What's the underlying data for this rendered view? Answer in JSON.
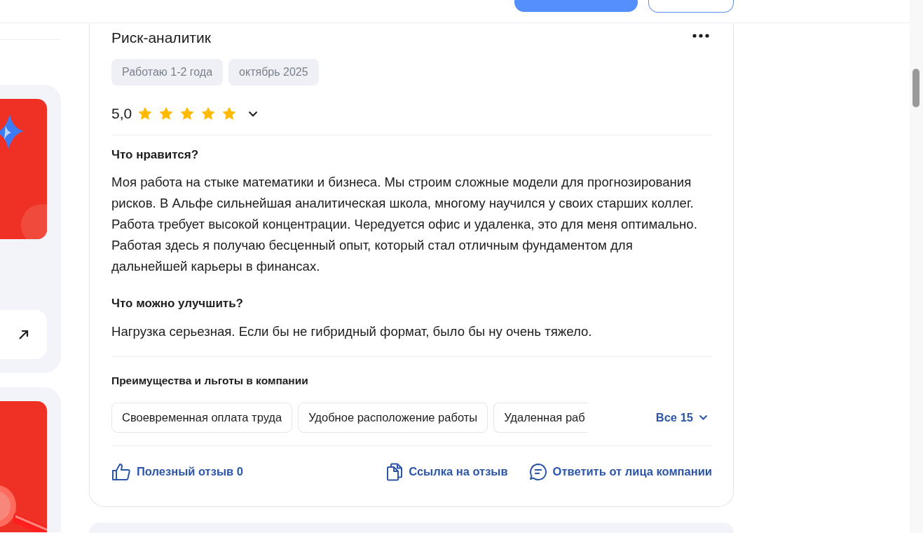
{
  "review": {
    "title": "Риск-аналитик",
    "tags": [
      "Работаю 1-2 года",
      "октябрь 2025"
    ],
    "rating": "5,0",
    "stars": 5,
    "sections": [
      {
        "heading": "Что нравится?",
        "text": "Моя работа на стыке математики и бизнеса. Мы строим сложные модели для прогнозирования рисков. В Альфе сильнейшая аналитическая школа, многому научился у своих старших коллег. Работа требует высокой концентрации. Чередуется офис и удаленка, это для меня оптимально. Работая здесь я получаю бесценный опыт, который стал отличным фундаментом для дальнейшей карьеры в финансах."
      },
      {
        "heading": "Что можно улучшить?",
        "text": "Нагрузка серьезная. Если бы не гибридный формат, было бы ну очень тяжело."
      }
    ],
    "benefits_title": "Преимущества и льготы в компании",
    "benefits": [
      "Своевременная оплата труда",
      "Удобное расположение работы",
      "Удаленная раб"
    ],
    "benefits_more": "Все 15",
    "actions": [
      {
        "kind": "like",
        "label": "Полезный отзыв 0"
      },
      {
        "kind": "link",
        "label": "Ссылка на отзыв"
      },
      {
        "kind": "reply",
        "label": "Ответить от лица компании"
      }
    ]
  }
}
